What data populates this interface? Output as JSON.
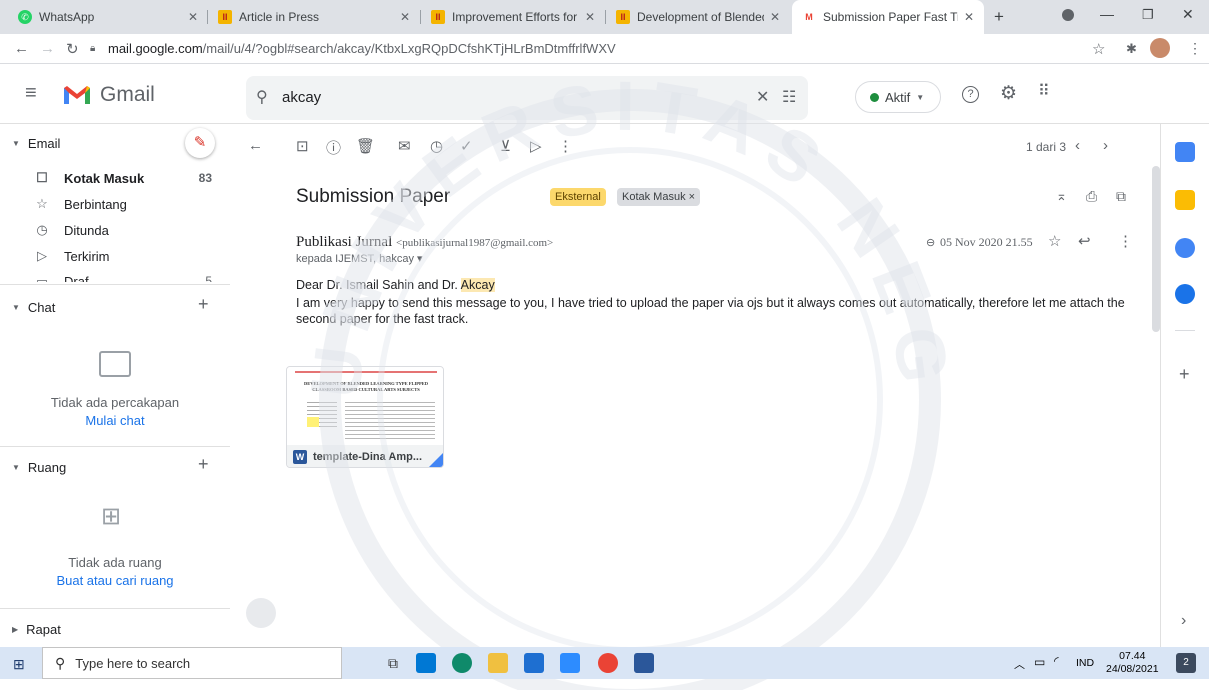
{
  "browser": {
    "tabs": [
      {
        "title": "WhatsApp",
        "favicon": "whatsapp-icon"
      },
      {
        "title": "Article in Press",
        "favicon": "ijemst-icon"
      },
      {
        "title": "Improvement Efforts for Stud",
        "favicon": "ijemst-icon"
      },
      {
        "title": "Development of Blended Lea",
        "favicon": "ijemst-icon"
      },
      {
        "title": "Submission Paper Fast Track",
        "favicon": "gmail-icon",
        "active": true
      }
    ],
    "url_host": "mail.google.com",
    "url_path": "/mail/u/4/?ogbl#search/akcay/KtbxLxgRQpDCfshKTjHLrBmDtmffrlfWXV"
  },
  "gmail": {
    "logo_text": "Gmail",
    "search_value": "akcay",
    "status_label": "Aktif",
    "status_color": "#1e8e3e"
  },
  "sidebar": {
    "email_header": "Email",
    "items": [
      {
        "label": "Kotak Masuk",
        "count": "83",
        "icon": "inbox-icon"
      },
      {
        "label": "Berbintang",
        "count": "",
        "icon": "star-icon"
      },
      {
        "label": "Ditunda",
        "count": "",
        "icon": "clock-icon"
      },
      {
        "label": "Terkirim",
        "count": "",
        "icon": "send-icon"
      },
      {
        "label": "Draf",
        "count": "5",
        "icon": "draft-icon"
      }
    ],
    "chat_header": "Chat",
    "chat_empty": "Tidak ada percakapan",
    "chat_link": "Mulai chat",
    "rooms_header": "Ruang",
    "rooms_empty": "Tidak ada ruang",
    "rooms_link": "Buat atau cari ruang",
    "meet_header": "Rapat"
  },
  "toolbar": {
    "pager": "1 dari 3"
  },
  "message": {
    "subject": "Submission Paper",
    "labels": [
      {
        "text": "Eksternal",
        "bg": "#fcd86c",
        "color": "#5f4400"
      },
      {
        "text": "Kotak Masuk ×",
        "bg": "#dadce0",
        "color": "#3c4043"
      }
    ],
    "sender_name": "Publikasi Jurnal",
    "sender_email": "<publikasijurnal1987@gmail.com>",
    "date": "05 Nov 2020 21.55",
    "recipients": "kepada IJEMST, hakcay ▾",
    "greeting_prefix": "Dear Dr. Ismail Sahin and Dr. ",
    "greeting_highlight": "Akcay",
    "body": "I am very happy to send this message to you, I have tried to upload the paper via ojs but it always comes out automatically, therefore let me attach the second paper for the fast track.",
    "attachment_name": "template-Dina Amp...",
    "attachment_preview_title": "DEVELOPMENT OF BLENDED LEARNING TYPE FLIPPED CLASSROOM BASED CULTURAL ARTS SUBJECTS"
  },
  "taskbar": {
    "search_placeholder": "Type here to search",
    "lang": "IND",
    "time": "07.44",
    "date": "24/08/2021",
    "notif_count": "2"
  },
  "watermark_text": "UNIVERSITAS NEGERI MEDAN"
}
